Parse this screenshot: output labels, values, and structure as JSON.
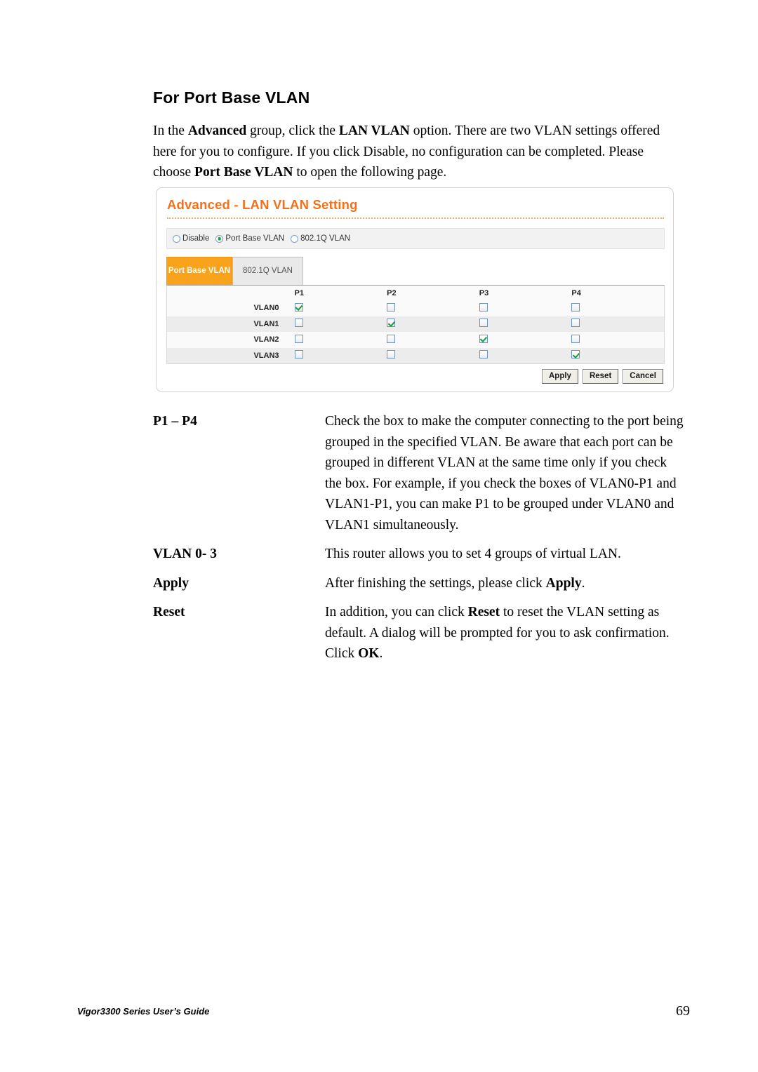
{
  "page": {
    "heading": "For Port Base VLAN",
    "intro_parts": [
      {
        "t": "In the ",
        "b": false
      },
      {
        "t": "Advanced",
        "b": true
      },
      {
        "t": " group, click the ",
        "b": false
      },
      {
        "t": "LAN VLAN",
        "b": true
      },
      {
        "t": " option. There are two VLAN settings offered here for you to configure. If you click Disable, no configuration can be completed. Please choose ",
        "b": false
      },
      {
        "t": "Port Base VLAN",
        "b": true
      },
      {
        "t": " to open the following page.",
        "b": false
      }
    ]
  },
  "screenshot": {
    "title": "Advanced - LAN VLAN Setting",
    "title_color": "#F4701B",
    "accent_color": "#F9A21B",
    "radio_options": [
      {
        "label": "Disable",
        "selected": false
      },
      {
        "label": "Port Base VLAN",
        "selected": true
      },
      {
        "label": "802.1Q VLAN",
        "selected": false
      }
    ],
    "tabs": [
      {
        "label": "Port Base VLAN",
        "active": true
      },
      {
        "label": "802.1Q VLAN",
        "active": false
      }
    ],
    "table": {
      "corner_header": "",
      "port_headers": [
        "P1",
        "P2",
        "P3",
        "P4"
      ],
      "rows": [
        {
          "label": "VLAN0",
          "checks": [
            true,
            false,
            false,
            false
          ]
        },
        {
          "label": "VLAN1",
          "checks": [
            false,
            true,
            false,
            false
          ]
        },
        {
          "label": "VLAN2",
          "checks": [
            false,
            false,
            true,
            false
          ]
        },
        {
          "label": "VLAN3",
          "checks": [
            false,
            false,
            false,
            true
          ]
        }
      ]
    },
    "buttons": [
      {
        "label": "Apply"
      },
      {
        "label": "Reset"
      },
      {
        "label": "Cancel"
      }
    ]
  },
  "definitions": [
    {
      "term": "P1 – P4",
      "desc_parts": [
        {
          "t": "Check the box to make the computer connecting to the port being grouped in the specified VLAN. Be aware that each port can be grouped in different VLAN at the same time only if you check the box. For example, if you check the boxes of VLAN0-P1 and VLAN1-P1, you can make P1 to be grouped under VLAN0 and VLAN1 simultaneously.",
          "b": false
        }
      ]
    },
    {
      "term": "VLAN 0- 3",
      "desc_parts": [
        {
          "t": "This router allows you to set 4 groups of virtual LAN.",
          "b": false
        }
      ]
    },
    {
      "term": "Apply",
      "desc_parts": [
        {
          "t": "After finishing the settings, please click ",
          "b": false
        },
        {
          "t": "Apply",
          "b": true
        },
        {
          "t": ".",
          "b": false
        }
      ]
    },
    {
      "term": "Reset",
      "desc_parts": [
        {
          "t": "In addition, you can click ",
          "b": false
        },
        {
          "t": "Reset",
          "b": true
        },
        {
          "t": " to reset the VLAN setting as default. A dialog will be prompted for you to ask confirmation. Click ",
          "b": false
        },
        {
          "t": "OK",
          "b": true
        },
        {
          "t": ".",
          "b": false
        }
      ]
    }
  ],
  "footer": {
    "left": "Vigor3300 Series User’s Guide",
    "page_number": "69"
  }
}
